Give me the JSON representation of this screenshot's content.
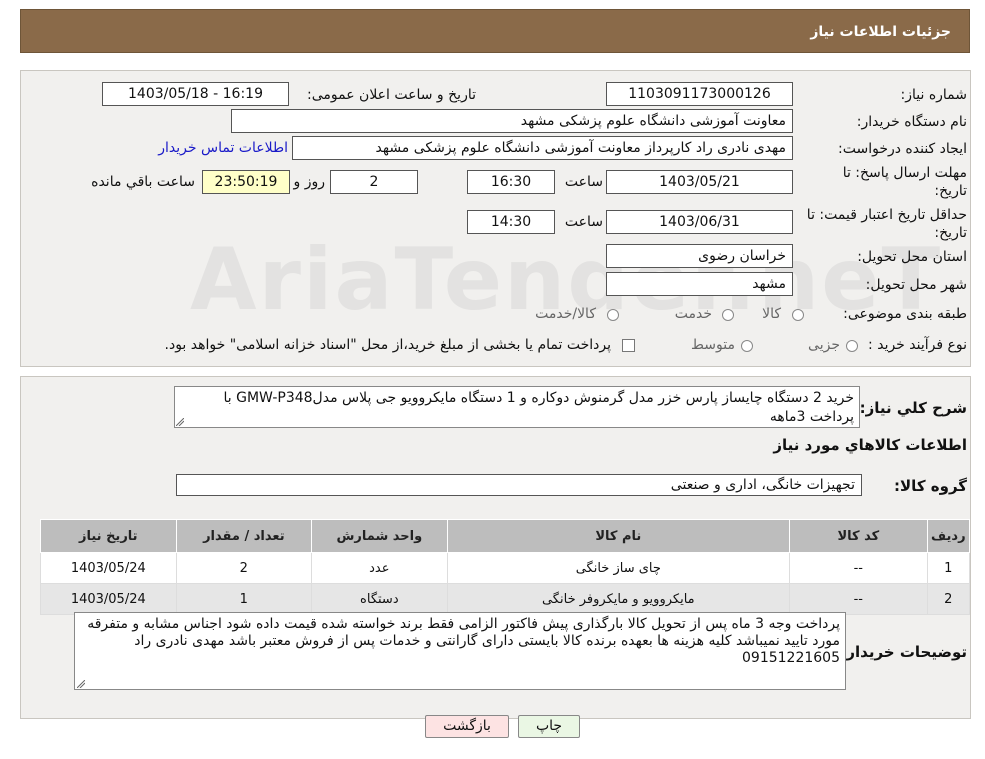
{
  "header": {
    "title": "جزئیات اطلاعات نیاز"
  },
  "watermark_text": "AriaTender.neT",
  "details": {
    "need_number_label": "شماره نیاز:",
    "need_number": "1103091173000126",
    "announce_label": "تاریخ و ساعت اعلان عمومی:",
    "announce_value": "1403/05/18 - 16:19",
    "buyer_org_label": "نام دستگاه خریدار:",
    "buyer_org": "معاونت آموزشی دانشگاه علوم پزشکی مشهد",
    "creator_label": "ایجاد کننده درخواست:",
    "creator": "مهدی نادری راد کارپرداز معاونت آموزشی دانشگاه علوم پزشکی مشهد",
    "contact_link": "اطلاعات تماس خریدار",
    "deadline_label_1": "مهلت ارسال پاسخ: تا",
    "deadline_label_2": "تاریخ:",
    "deadline_date": "1403/05/21",
    "time_label": "ساعت",
    "deadline_time": "16:30",
    "days_value": "2",
    "days_label": "روز و",
    "remaining_time": "23:50:19",
    "remaining_label": "ساعت باقي مانده",
    "validity_label_1": "حداقل تاریخ اعتبار قیمت: تا",
    "validity_label_2": "تاریخ:",
    "validity_date": "1403/06/31",
    "validity_time": "14:30",
    "province_label": "استان محل تحویل:",
    "province": "خراسان رضوی",
    "city_label": "شهر محل تحویل:",
    "city": "مشهد",
    "category_label": "طبقه بندی موضوعی:",
    "category_options": [
      "کالا",
      "خدمت",
      "کالا/خدمت"
    ],
    "process_label": "نوع فرآیند خرید :",
    "process_options": [
      "جزیی",
      "متوسط"
    ],
    "payment_note": "پرداخت تمام یا بخشی از مبلغ خرید،از محل \"اسناد خزانه اسلامی\" خواهد بود."
  },
  "summary": {
    "label": "شرح کلي نياز:",
    "text": "خرید 2 دستگاه چایساز پارس خزر مدل گرمنوش دوکاره و 1 دستگاه مایکروویو جی پلاس مدلGMW-P348 با پرداخت  3ماهه",
    "goods_info_title": "اطلاعات کالاهاي مورد نياز",
    "group_label": "گروه کالا:",
    "group_value": "تجهیزات خانگی، اداری و صنعتی"
  },
  "table": {
    "headers": [
      "رديف",
      "کد کالا",
      "نام کالا",
      "واحد شمارش",
      "تعداد / مقدار",
      "تاريخ نياز"
    ],
    "rows": [
      [
        "1",
        "--",
        "چای ساز خانگی",
        "عدد",
        "2",
        "1403/05/24"
      ],
      [
        "2",
        "--",
        "مایکروویو و مایکروفر خانگی",
        "دستگاه",
        "1",
        "1403/05/24"
      ]
    ]
  },
  "buyer_notes": {
    "label": "توضیحات خریدار:",
    "text": "پرداخت وجه 3 ماه پس از تحویل کالا بارگذاری پیش فاکتور الزامی فقط برند خواسته شده قیمت داده شود اجناس مشابه و متفرقه مورد تایید نمیباشد کلیه هزینه ها بعهده برنده کالا بایستی دارای گارانتی و خدمات پس از فروش معتبر باشد مهدی نادری راد 09151221605"
  },
  "buttons": {
    "print": "چاپ",
    "back": "بازگشت"
  },
  "colors": {
    "header": "#8a6a49",
    "back_button_bg": "#fde3e3",
    "print_button_bg": "#eaf7e4",
    "remaining_bg": "#ffffc8",
    "link": "#1a1ac8"
  }
}
